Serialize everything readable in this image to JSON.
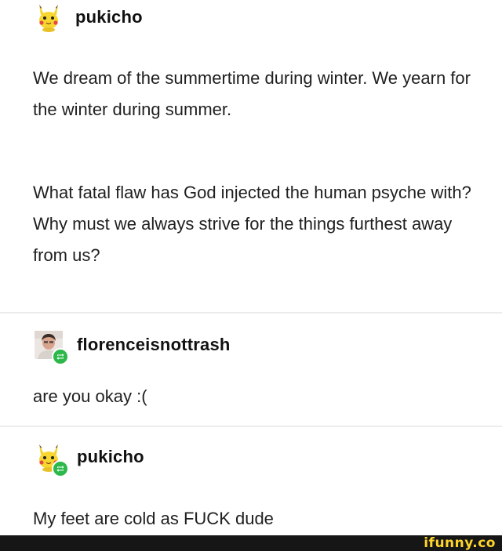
{
  "post": {
    "author": {
      "username": "pukicho",
      "avatar_icon": "pikachu-icon"
    },
    "paragraphs": [
      "We dream of the summertime during winter. We yearn for the winter during summer.",
      "What fatal flaw has God injected the human psyche with? Why must we always strive for the things furthest away from us?"
    ]
  },
  "reblogs": [
    {
      "username": "florenceisnottrash",
      "avatar_icon": "user-photo-icon",
      "badge_icon": "reblog-icon",
      "text": "are you okay :("
    },
    {
      "username": "pukicho",
      "avatar_icon": "pikachu-icon",
      "badge_icon": "reblog-icon",
      "text": "My feet are cold as FUCK dude"
    }
  ],
  "watermark": {
    "text": "ifunny.co"
  },
  "colors": {
    "reblog_badge": "#2cb84b",
    "watermark": "#ffd52b",
    "footer_bar": "#161616",
    "divider": "#ececec"
  }
}
